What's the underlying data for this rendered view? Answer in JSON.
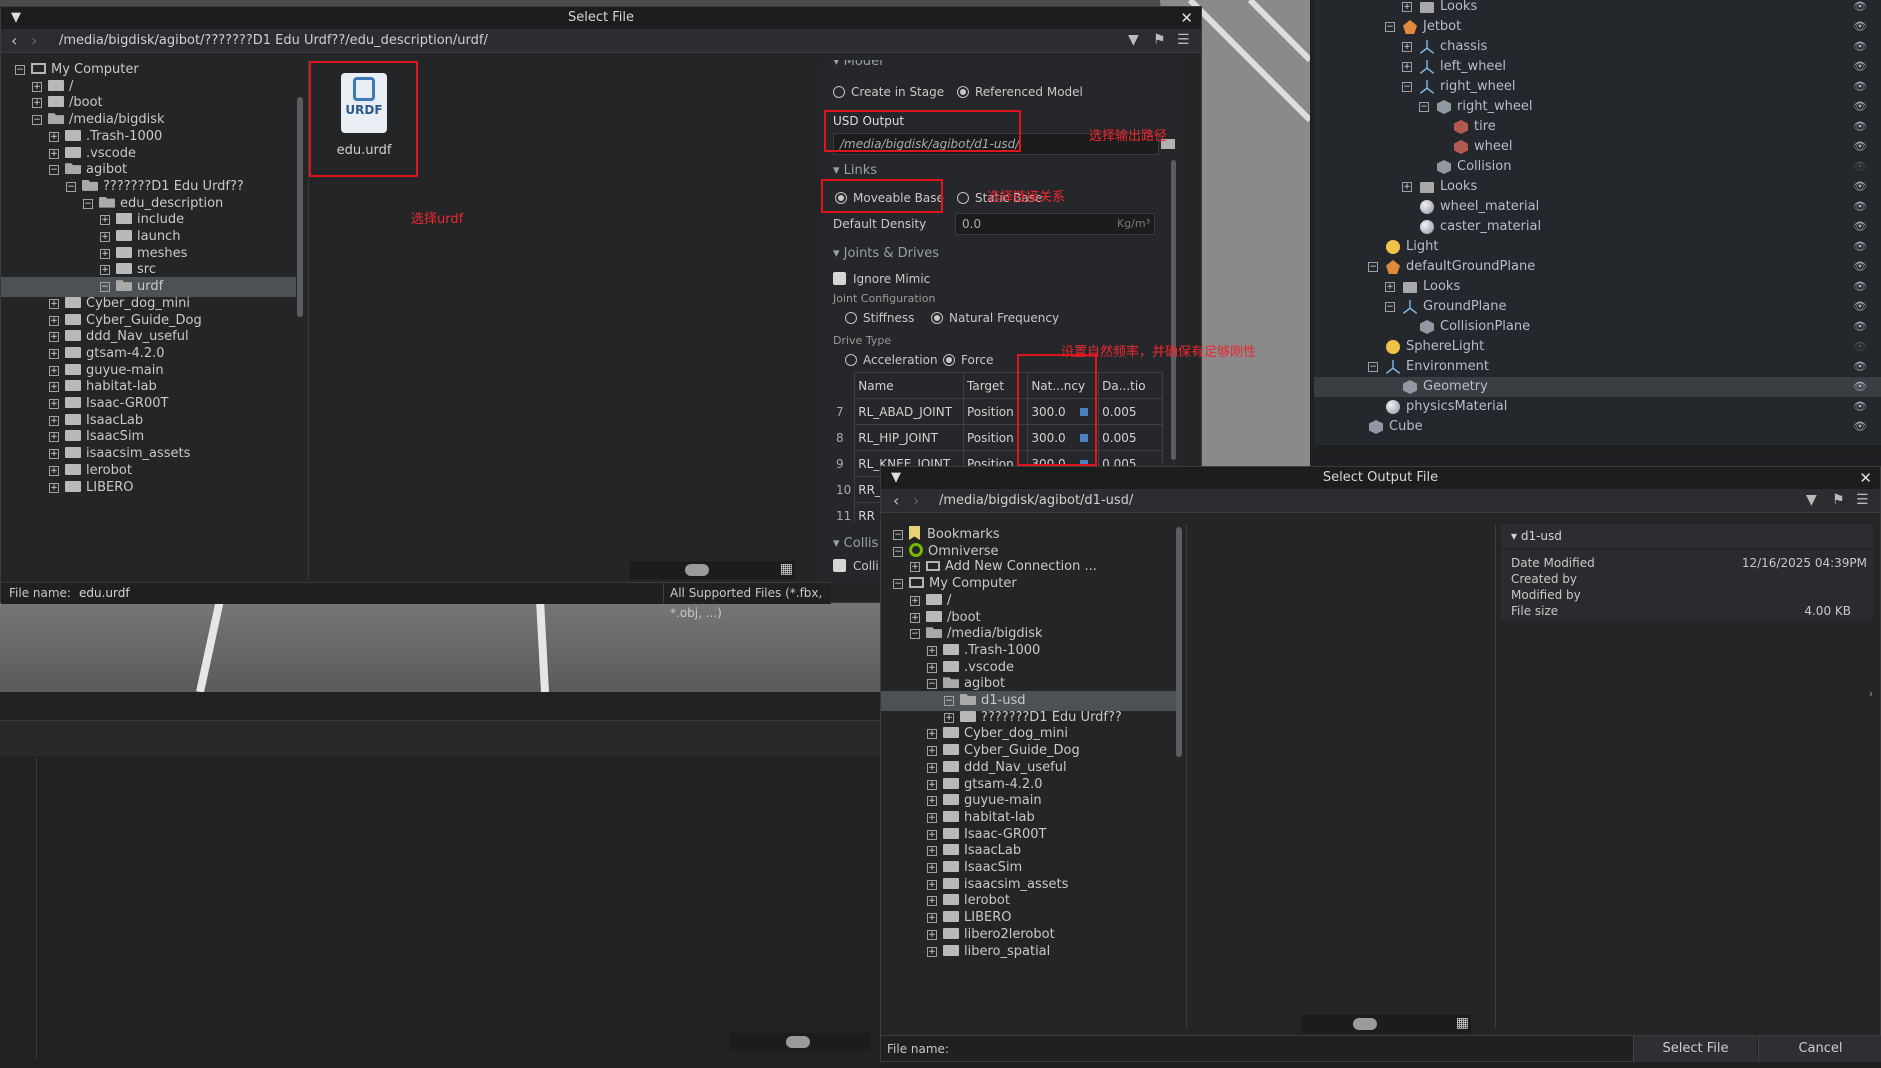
{
  "select_file_dialog": {
    "title": "Select File",
    "path": "/media/bigdisk/agibot/???????D1 Edu Urdf??/edu_description/urdf/",
    "tree": [
      {
        "label": "My Computer",
        "depth": 0,
        "toggle": "-",
        "kind": "computer"
      },
      {
        "label": "/",
        "depth": 1,
        "toggle": "+",
        "kind": "folder"
      },
      {
        "label": "/boot",
        "depth": 1,
        "toggle": "+",
        "kind": "folder"
      },
      {
        "label": "/media/bigdisk",
        "depth": 1,
        "toggle": "-",
        "kind": "open"
      },
      {
        "label": ".Trash-1000",
        "depth": 2,
        "toggle": "+",
        "kind": "folder"
      },
      {
        "label": ".vscode",
        "depth": 2,
        "toggle": "+",
        "kind": "folder"
      },
      {
        "label": "agibot",
        "depth": 2,
        "toggle": "-",
        "kind": "open"
      },
      {
        "label": "???????D1 Edu Urdf??",
        "depth": 3,
        "toggle": "-",
        "kind": "open"
      },
      {
        "label": "edu_description",
        "depth": 4,
        "toggle": "-",
        "kind": "open"
      },
      {
        "label": "include",
        "depth": 5,
        "toggle": "+",
        "kind": "folder"
      },
      {
        "label": "launch",
        "depth": 5,
        "toggle": "+",
        "kind": "folder"
      },
      {
        "label": "meshes",
        "depth": 5,
        "toggle": "+",
        "kind": "folder"
      },
      {
        "label": "src",
        "depth": 5,
        "toggle": "+",
        "kind": "folder"
      },
      {
        "label": "urdf",
        "depth": 5,
        "toggle": "-",
        "kind": "open",
        "selected": true
      },
      {
        "label": "Cyber_dog_mini",
        "depth": 2,
        "toggle": "+",
        "kind": "folder"
      },
      {
        "label": "Cyber_Guide_Dog",
        "depth": 2,
        "toggle": "+",
        "kind": "folder"
      },
      {
        "label": "ddd_Nav_useful",
        "depth": 2,
        "toggle": "+",
        "kind": "folder"
      },
      {
        "label": "gtsam-4.2.0",
        "depth": 2,
        "toggle": "+",
        "kind": "folder"
      },
      {
        "label": "guyue-main",
        "depth": 2,
        "toggle": "+",
        "kind": "folder"
      },
      {
        "label": "habitat-lab",
        "depth": 2,
        "toggle": "+",
        "kind": "folder"
      },
      {
        "label": "Isaac-GR00T",
        "depth": 2,
        "toggle": "+",
        "kind": "folder"
      },
      {
        "label": "IsaacLab",
        "depth": 2,
        "toggle": "+",
        "kind": "folder"
      },
      {
        "label": "IsaacSim",
        "depth": 2,
        "toggle": "+",
        "kind": "folder"
      },
      {
        "label": "isaacsim_assets",
        "depth": 2,
        "toggle": "+",
        "kind": "folder"
      },
      {
        "label": "lerobot",
        "depth": 2,
        "toggle": "+",
        "kind": "folder"
      },
      {
        "label": "LIBERO",
        "depth": 2,
        "toggle": "+",
        "kind": "folder"
      }
    ],
    "file_item": {
      "name": "edu.urdf",
      "icon_text": "URDF"
    },
    "annotation_select_urdf": "选择urdf",
    "file_name_label": "File name:",
    "file_name_value": "edu.urdf",
    "filter": "All Supported Files (*.fbx, *.obj, ...)"
  },
  "import_options": {
    "model_section": "Model",
    "create_in_stage": "Create in Stage",
    "referenced_model": "Referenced Model",
    "usd_output_label": "USD Output",
    "usd_output_value": "/media/bigdisk/agibot/d1-usd/",
    "annotation_output_path": "选择输出路径",
    "links_section": "Links",
    "moveable_base": "Moveable Base",
    "static_base": "Static Base",
    "annotation_link": "选择链接关系",
    "default_density_label": "Default Density",
    "default_density_value": "0.0",
    "density_unit": "Kg/m³",
    "joints_section": "Joints & Drives",
    "ignore_mimic": "Ignore Mimic",
    "joint_config_label": "Joint Configuration",
    "stiffness": "Stiffness",
    "natural_frequency": "Natural Frequency",
    "drive_type_label": "Drive Type",
    "acceleration": "Acceleration",
    "force": "Force",
    "annotation_frequency": "设置自然频率，并确保有足够刚性",
    "table_headers": {
      "name": "Name",
      "target": "Target",
      "natfreq": "Nat...ncy",
      "damping": "Da...tio"
    },
    "joints": [
      {
        "idx": "7",
        "name": "RL_ABAD_JOINT",
        "target": "Position",
        "freq": "300.0",
        "damp": "0.005"
      },
      {
        "idx": "8",
        "name": "RL_HIP_JOINT",
        "target": "Position",
        "freq": "300.0",
        "damp": "0.005"
      },
      {
        "idx": "9",
        "name": "RL_KNEE_JOINT",
        "target": "Position",
        "freq": "300.0",
        "damp": "0.005"
      },
      {
        "idx": "10",
        "name": "RR_AB",
        "target": "",
        "freq": "",
        "damp": ""
      },
      {
        "idx": "11",
        "name": "RR_HI",
        "target": "",
        "freq": "",
        "damp": ""
      }
    ],
    "collision_section": "Collis",
    "collision_check": "Colli"
  },
  "stage_tree": [
    {
      "label": "Looks",
      "indent": 1,
      "toggle": "+",
      "icon": "folder",
      "eye": true
    },
    {
      "label": "Jetbot",
      "indent": 0,
      "toggle": "-",
      "icon": "robot",
      "eye": true
    },
    {
      "label": "chassis",
      "indent": 1,
      "toggle": "+",
      "icon": "xform",
      "eye": true
    },
    {
      "label": "left_wheel",
      "indent": 1,
      "toggle": "+",
      "icon": "xform",
      "eye": true
    },
    {
      "label": "right_wheel",
      "indent": 1,
      "toggle": "-",
      "icon": "xform",
      "eye": true
    },
    {
      "label": "right_wheel",
      "indent": 2,
      "toggle": "-",
      "icon": "cube",
      "eye": true
    },
    {
      "label": "tire",
      "indent": 3,
      "toggle": "",
      "icon": "mesh",
      "eye": true
    },
    {
      "label": "wheel",
      "indent": 3,
      "toggle": "",
      "icon": "mesh",
      "eye": true
    },
    {
      "label": "Collision",
      "indent": 2,
      "toggle": "",
      "icon": "cube",
      "eye": false
    },
    {
      "label": "Looks",
      "indent": 1,
      "toggle": "+",
      "icon": "folder",
      "eye": true
    },
    {
      "label": "wheel_material",
      "indent": 1,
      "toggle": "",
      "icon": "sphere",
      "eye": true
    },
    {
      "label": "caster_material",
      "indent": 1,
      "toggle": "",
      "icon": "sphere",
      "eye": true
    },
    {
      "label": "Light",
      "indent": -1,
      "toggle": "",
      "icon": "light",
      "eye": true
    },
    {
      "label": "defaultGroundPlane",
      "indent": -1,
      "toggle": "-",
      "icon": "robot",
      "eye": true
    },
    {
      "label": "Looks",
      "indent": 0,
      "toggle": "+",
      "icon": "folder",
      "eye": true
    },
    {
      "label": "GroundPlane",
      "indent": 0,
      "toggle": "-",
      "icon": "xform",
      "eye": true
    },
    {
      "label": "CollisionPlane",
      "indent": 1,
      "toggle": "",
      "icon": "cube",
      "eye": true
    },
    {
      "label": "SphereLight",
      "indent": -1,
      "toggle": "",
      "icon": "light",
      "eye": false
    },
    {
      "label": "Environment",
      "indent": -1,
      "toggle": "-",
      "icon": "xform",
      "eye": true
    },
    {
      "label": "Geometry",
      "indent": 0,
      "toggle": "",
      "icon": "cube",
      "eye": true,
      "selected": true
    },
    {
      "label": "physicsMaterial",
      "indent": -1,
      "toggle": "",
      "icon": "sphere",
      "eye": true
    },
    {
      "label": "Cube",
      "indent": -2,
      "toggle": "",
      "icon": "cube",
      "eye": true
    }
  ],
  "output_dialog": {
    "title": "Select Output File",
    "path": "/media/bigdisk/agibot/d1-usd/",
    "tree": [
      {
        "label": "Bookmarks",
        "depth": 0,
        "toggle": "-",
        "kind": "bookmark"
      },
      {
        "label": "Omniverse",
        "depth": 0,
        "toggle": "-",
        "kind": "omni"
      },
      {
        "label": "Add New Connection ...",
        "depth": 1,
        "toggle": "+",
        "kind": "connect"
      },
      {
        "label": "My Computer",
        "depth": 0,
        "toggle": "-",
        "kind": "computer"
      },
      {
        "label": "/",
        "depth": 1,
        "toggle": "+",
        "kind": "folder"
      },
      {
        "label": "/boot",
        "depth": 1,
        "toggle": "+",
        "kind": "folder"
      },
      {
        "label": "/media/bigdisk",
        "depth": 1,
        "toggle": "-",
        "kind": "open"
      },
      {
        "label": ".Trash-1000",
        "depth": 2,
        "toggle": "+",
        "kind": "folder"
      },
      {
        "label": ".vscode",
        "depth": 2,
        "toggle": "+",
        "kind": "folder"
      },
      {
        "label": "agibot",
        "depth": 2,
        "toggle": "-",
        "kind": "open"
      },
      {
        "label": "d1-usd",
        "depth": 3,
        "toggle": "-",
        "kind": "open",
        "selected": true
      },
      {
        "label": "???????D1 Edu Urdf??",
        "depth": 3,
        "toggle": "+",
        "kind": "folder"
      },
      {
        "label": "Cyber_dog_mini",
        "depth": 2,
        "toggle": "+",
        "kind": "folder"
      },
      {
        "label": "Cyber_Guide_Dog",
        "depth": 2,
        "toggle": "+",
        "kind": "folder"
      },
      {
        "label": "ddd_Nav_useful",
        "depth": 2,
        "toggle": "+",
        "kind": "folder"
      },
      {
        "label": "gtsam-4.2.0",
        "depth": 2,
        "toggle": "+",
        "kind": "folder"
      },
      {
        "label": "guyue-main",
        "depth": 2,
        "toggle": "+",
        "kind": "folder"
      },
      {
        "label": "habitat-lab",
        "depth": 2,
        "toggle": "+",
        "kind": "folder"
      },
      {
        "label": "Isaac-GR00T",
        "depth": 2,
        "toggle": "+",
        "kind": "folder"
      },
      {
        "label": "IsaacLab",
        "depth": 2,
        "toggle": "+",
        "kind": "folder"
      },
      {
        "label": "IsaacSim",
        "depth": 2,
        "toggle": "+",
        "kind": "folder"
      },
      {
        "label": "isaacsim_assets",
        "depth": 2,
        "toggle": "+",
        "kind": "folder"
      },
      {
        "label": "lerobot",
        "depth": 2,
        "toggle": "+",
        "kind": "folder"
      },
      {
        "label": "LIBERO",
        "depth": 2,
        "toggle": "+",
        "kind": "folder"
      },
      {
        "label": "libero2lerobot",
        "depth": 2,
        "toggle": "+",
        "kind": "folder"
      },
      {
        "label": "libero_spatial",
        "depth": 2,
        "toggle": "+",
        "kind": "folder"
      }
    ],
    "details": {
      "folder_name": "d1-usd",
      "date_modified_label": "Date Modified",
      "date_modified_value": "12/16/2025 04:39PM",
      "created_by_label": "Created by",
      "modified_by_label": "Modified by",
      "file_size_label": "File size",
      "file_size_value": "4.00 KB"
    },
    "file_name_label": "File name:",
    "select_button": "Select File",
    "cancel_button": "Cancel"
  },
  "colors": {
    "annotation_red": "#e0141d",
    "selection": "#4b5155",
    "dialog_bg": "#242527"
  }
}
